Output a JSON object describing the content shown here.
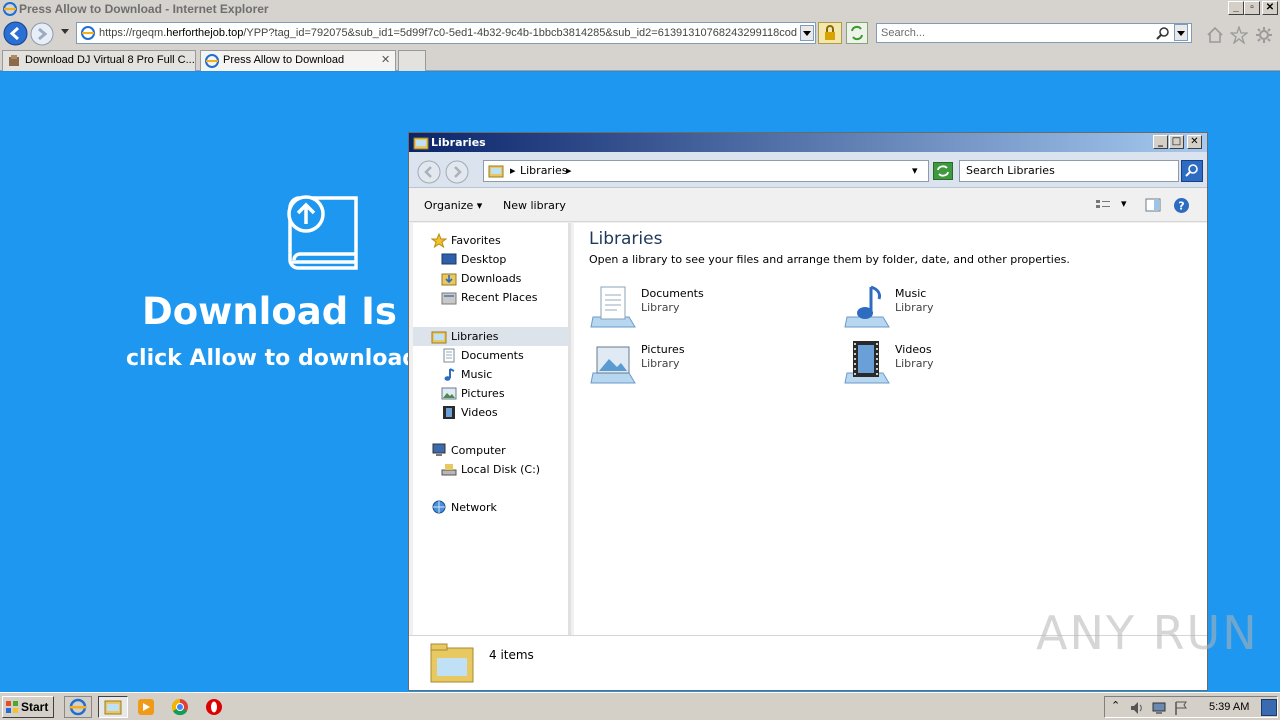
{
  "browser": {
    "title": "Press Allow to Download - Internet Explorer",
    "url_prefix": "https://rgeqm.",
    "url_domain": "herforthejob.top",
    "url_rest": "/YPP?tag_id=792075&sub_id1=5d99f7c0-5ed1-4b32-9c4b-1bbcb3814285&sub_id2=61391310768243299118cod",
    "search_placeholder": "Search...",
    "tabs": [
      {
        "label": "Download DJ Virtual 8 Pro Full C..."
      },
      {
        "label": "Press Allow to Download"
      }
    ]
  },
  "page": {
    "heading": "Download Is R",
    "subheading": "click Allow to download"
  },
  "explorer": {
    "title": "Libraries",
    "breadcrumb": "Libraries",
    "search_placeholder": "Search Libraries",
    "toolbar": {
      "organize": "Organize",
      "new_library": "New library"
    },
    "nav": {
      "favorites": "Favorites",
      "desktop": "Desktop",
      "downloads": "Downloads",
      "recent_places": "Recent Places",
      "libraries": "Libraries",
      "documents": "Documents",
      "music": "Music",
      "pictures": "Pictures",
      "videos": "Videos",
      "computer": "Computer",
      "local_disk": "Local Disk (C:)",
      "network": "Network"
    },
    "main": {
      "heading": "Libraries",
      "description": "Open a library to see your files and arrange them by folder, date, and other properties.",
      "libraries": [
        {
          "name": "Documents",
          "type": "Library"
        },
        {
          "name": "Music",
          "type": "Library"
        },
        {
          "name": "Pictures",
          "type": "Library"
        },
        {
          "name": "Videos",
          "type": "Library"
        }
      ]
    },
    "status": "4 items"
  },
  "taskbar": {
    "start": "Start",
    "clock": "5:39 AM"
  },
  "watermark": "ANY RUN",
  "colors": {
    "page_bg": "#1e97f0",
    "title_gradient_start": "#0a246a"
  }
}
